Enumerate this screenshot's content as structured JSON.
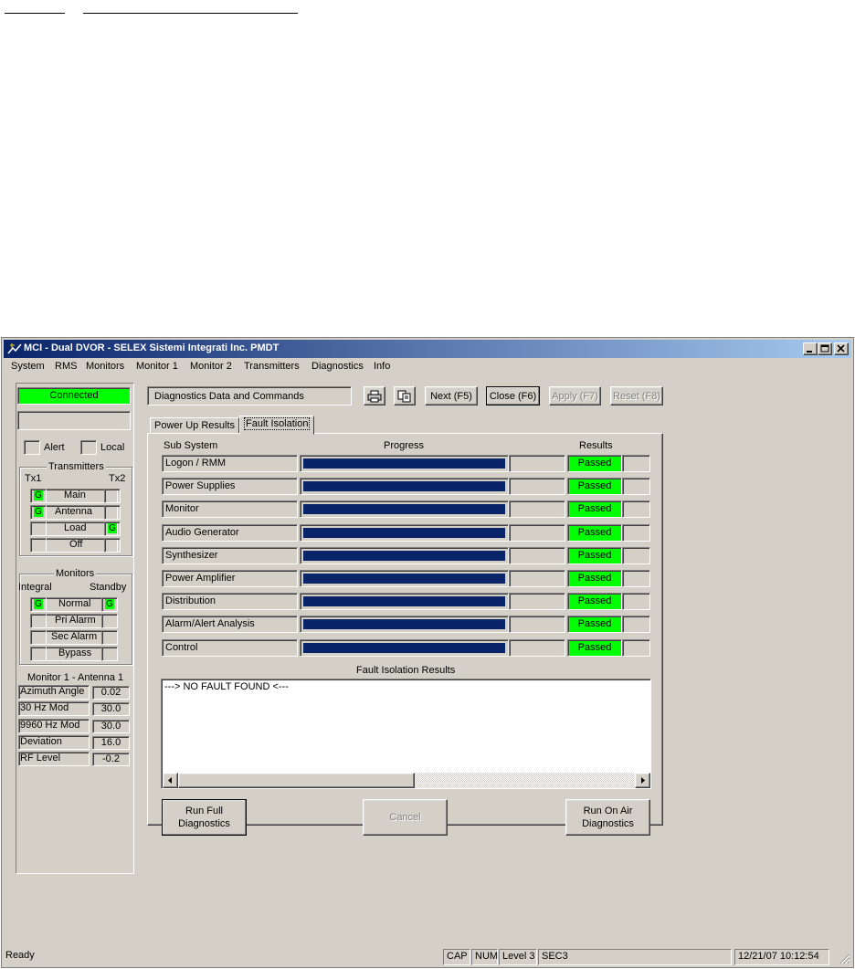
{
  "window": {
    "title": "MCI - Dual DVOR - SELEX Sistemi Integrati Inc. PMDT"
  },
  "menu": [
    "System",
    "RMS",
    "Monitors",
    "Monitor 1",
    "Monitor 2",
    "Transmitters",
    "Diagnostics",
    "Info"
  ],
  "status_panel": {
    "connection": "Connected",
    "alert_label": "Alert",
    "local_label": "Local"
  },
  "transmitters": {
    "title": "Transmitters",
    "tx1": "Tx1",
    "tx2": "Tx2",
    "rows": [
      {
        "label": "Main",
        "left": "G",
        "right": ""
      },
      {
        "label": "Antenna",
        "left": "G",
        "right": ""
      },
      {
        "label": "Load",
        "left": "",
        "right": "G"
      },
      {
        "label": "Off",
        "left": "",
        "right": ""
      }
    ]
  },
  "monitors": {
    "title": "Monitors",
    "integral": "Integral",
    "standby": "Standby",
    "rows": [
      {
        "label": "Normal",
        "left": "G",
        "right": "G"
      },
      {
        "label": "Pri Alarm",
        "left": "",
        "right": ""
      },
      {
        "label": "Sec Alarm",
        "left": "",
        "right": ""
      },
      {
        "label": "Bypass",
        "left": "",
        "right": ""
      }
    ],
    "section_title": "Monitor 1 - Antenna 1",
    "params": [
      {
        "label": "Azimuth Angle",
        "value": "0.02"
      },
      {
        "label": "30 Hz Mod",
        "value": "30.0"
      },
      {
        "label": "9960 Hz Mod",
        "value": "30.0"
      },
      {
        "label": "Deviation",
        "value": "16.0"
      },
      {
        "label": "RF Level",
        "value": "-0.2"
      }
    ]
  },
  "toolbar": {
    "title": "Diagnostics Data and Commands",
    "print_icon": "printer-icon",
    "copy_icon": "copy-icon",
    "next": "Next (F5)",
    "close": "Close (F6)",
    "apply": "Apply (F7)",
    "reset": "Reset (F8)"
  },
  "tabs": [
    "Power Up Results",
    "Fault Isolation"
  ],
  "table": {
    "headers": {
      "subsystem": "Sub System",
      "progress": "Progress",
      "results": "Results"
    },
    "rows": [
      {
        "name": "Logon / RMM",
        "progress": 1.0,
        "result": "Passed"
      },
      {
        "name": "Power Supplies",
        "progress": 1.0,
        "result": "Passed"
      },
      {
        "name": "Monitor",
        "progress": 1.0,
        "result": "Passed"
      },
      {
        "name": "Audio Generator",
        "progress": 1.0,
        "result": "Passed"
      },
      {
        "name": "Synthesizer",
        "progress": 1.0,
        "result": "Passed"
      },
      {
        "name": "Power Amplifier",
        "progress": 1.0,
        "result": "Passed"
      },
      {
        "name": "Distribution",
        "progress": 1.0,
        "result": "Passed"
      },
      {
        "name": "Alarm/Alert Analysis",
        "progress": 1.0,
        "result": "Passed"
      },
      {
        "name": "Control",
        "progress": 1.0,
        "result": "Passed"
      }
    ]
  },
  "fault_results": {
    "title": "Fault Isolation Results",
    "text": "---> NO FAULT FOUND <---"
  },
  "buttons": {
    "run_full_l1": "Run Full",
    "run_full_l2": "Diagnostics",
    "cancel": "Cancel",
    "run_on_air_l1": "Run On Air",
    "run_on_air_l2": "Diagnostics"
  },
  "statusbar": {
    "ready": "Ready",
    "cap": "CAP",
    "num": "NUM",
    "level": "Level 3",
    "sec": "SEC3",
    "datetime": "12/21/07 10:12:54"
  },
  "colors": {
    "ok_green": "#00ff00",
    "progress_navy": "#0a246a",
    "face": "#d4d0c8"
  }
}
